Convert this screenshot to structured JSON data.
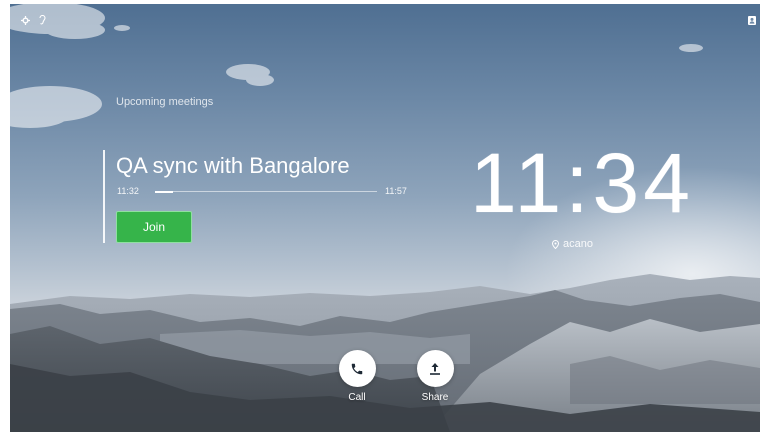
{
  "status_bar": {
    "left_icons": [
      "settings-icon",
      "hearing-icon"
    ],
    "right_icon": "contacts-icon"
  },
  "upcoming": {
    "header": "Upcoming meetings",
    "meeting": {
      "title": "QA sync with Bangalore",
      "start_time": "11:32",
      "end_time": "11:57",
      "progress": 0.08,
      "join_label": "Join"
    }
  },
  "clock": {
    "time": "11:34"
  },
  "location": {
    "icon": "location-pin-icon",
    "name": "acano"
  },
  "actions": [
    {
      "label": "Call",
      "icon": "phone-icon"
    },
    {
      "label": "Share",
      "icon": "share-upload-icon"
    }
  ],
  "colors": {
    "join_button": "#36b44a",
    "text": "#ffffff"
  }
}
